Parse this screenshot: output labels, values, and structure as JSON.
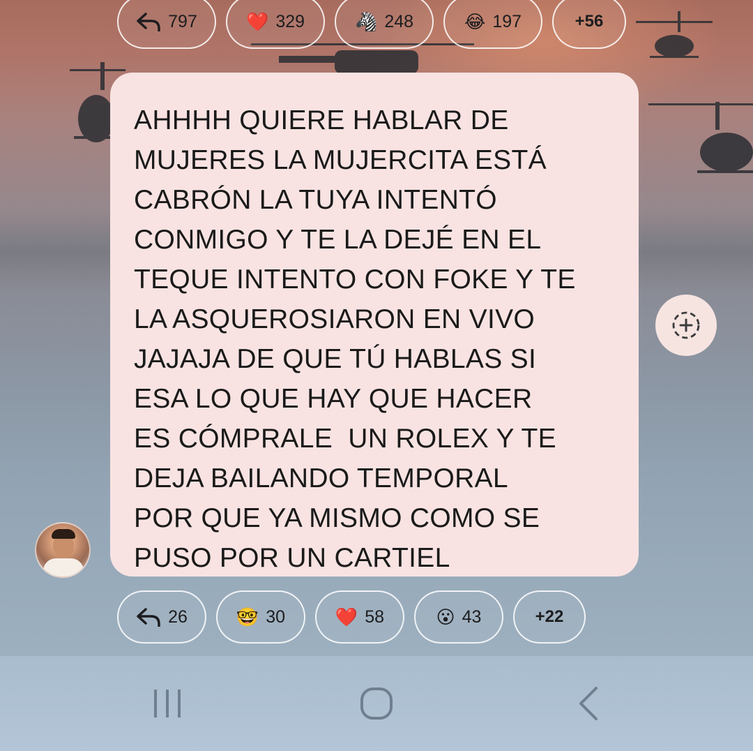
{
  "top_reactions": [
    {
      "kind": "reply",
      "icon": "reply-arrow-icon",
      "count": "797"
    },
    {
      "kind": "emoji",
      "icon": "heart-icon",
      "emoji": "❤️",
      "count": "329"
    },
    {
      "kind": "emoji",
      "icon": "zebra-icon",
      "emoji": "🦓",
      "count": "248"
    },
    {
      "kind": "emoji",
      "icon": "tears-of-joy-icon",
      "emoji": "😂",
      "count": "197"
    },
    {
      "kind": "more",
      "count": "+56"
    }
  ],
  "message": {
    "text": "AHHHH QUIERE HABLAR DE\nMUJERES LA MUJERCITA ESTÁ\nCABRÓN LA TUYA INTENTÓ\nCONMIGO Y TE LA DEJÉ EN EL\nTEQUE INTENTO CON FOKE Y TE\nLA ASQUEROSIARON EN VIVO\nJAJAJA DE QUE TÚ HABLAS SI\nESA LO QUE HAY QUE HACER\nES CÓMPRALE  UN ROLEX Y TE\nDEJA BAILANDO TEMPORAL\nPOR QUE YA MISMO COMO SE\nPUSO POR UN CARTIEL"
  },
  "bottom_reactions": [
    {
      "kind": "reply",
      "icon": "reply-arrow-icon",
      "count": "26"
    },
    {
      "kind": "emoji",
      "icon": "nerd-face-icon",
      "emoji": "🤓",
      "count": "30"
    },
    {
      "kind": "emoji",
      "icon": "heart-icon",
      "emoji": "❤️",
      "count": "58"
    },
    {
      "kind": "emoji",
      "icon": "surprised-face-icon",
      "emoji": "😮",
      "count": "43"
    },
    {
      "kind": "more",
      "count": "+22"
    }
  ],
  "colors": {
    "bubble": "#f8e3e2",
    "text": "#1a1a1a",
    "navbar": "#b3c5d6"
  }
}
